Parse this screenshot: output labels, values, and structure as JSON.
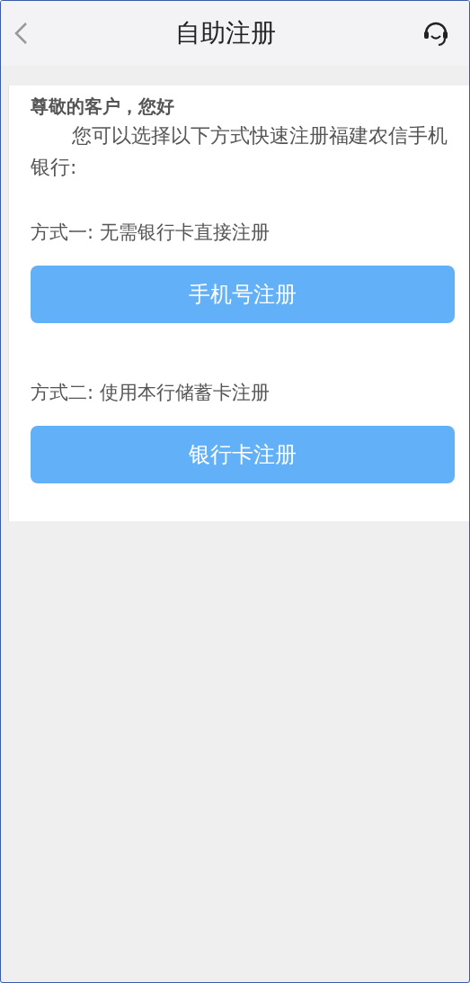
{
  "header": {
    "title": "自助注册"
  },
  "greeting": "尊敬的客户，您好",
  "intro": "您可以选择以下方式快速注册福建农信手机银行:",
  "options": [
    {
      "label": "方式一:  无需银行卡直接注册",
      "button": "手机号注册"
    },
    {
      "label": "方式二:  使用本行储蓄卡注册",
      "button": "银行卡注册"
    }
  ]
}
